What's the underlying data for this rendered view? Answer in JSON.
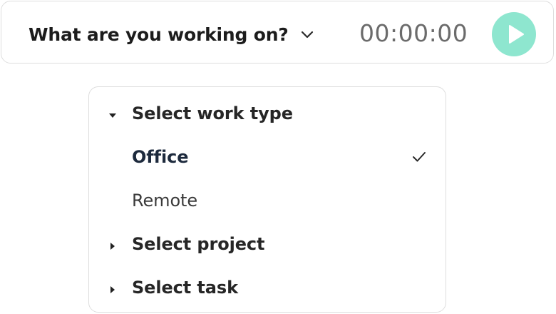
{
  "timer": {
    "task_placeholder": "What are you working on?",
    "elapsed": "00:00:00",
    "play_button_color": "#8ee6cf",
    "icons": {
      "chevron": "chevron-down-icon",
      "play": "play-icon"
    }
  },
  "dropdown": {
    "groups": [
      {
        "label": "Select work type",
        "expanded": true,
        "options": [
          {
            "label": "Office",
            "selected": true
          },
          {
            "label": "Remote",
            "selected": false
          }
        ]
      },
      {
        "label": "Select project",
        "expanded": false
      },
      {
        "label": "Select task",
        "expanded": false
      }
    ],
    "icons": {
      "expanded": "caret-down-icon",
      "collapsed": "caret-right-icon",
      "selected": "checkmark-icon"
    }
  }
}
